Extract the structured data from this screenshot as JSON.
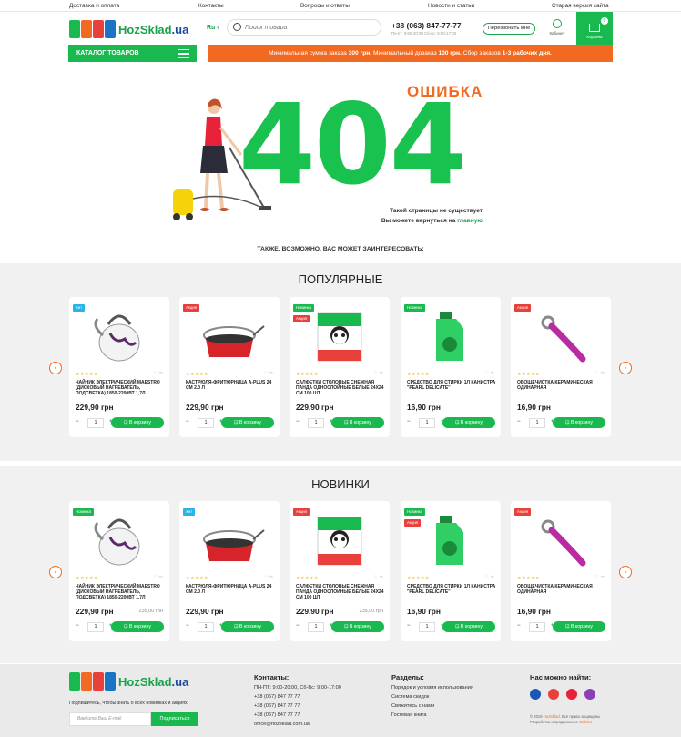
{
  "topbar": {
    "links": [
      "Доставка и оплата",
      "Контакты",
      "Вопросы и ответы",
      "Новости и статьи",
      "Старая версия сайта"
    ]
  },
  "header": {
    "logo_text_green": "HozSklad",
    "logo_text_blue": ".ua",
    "lang": "Ru",
    "search_placeholder": "Поиск товара",
    "phone": "+38 (063) 847-77-77",
    "hours": "Пн-пт: 9:00-20:00 Сб-вс: 9:00-17:00",
    "callback_label": "Перезвонить мне",
    "cabinet_label": "Кабинет",
    "cart_label": "Корзина",
    "cart_count": "0"
  },
  "nav": {
    "catalog_label": "КАТАЛОГ ТОВАРОВ",
    "promo_pre": "Минимальная сумма заказа ",
    "promo_b1": "300 грн.",
    "promo_mid": " Минимальный дозаказ ",
    "promo_b2": "100 грн.",
    "promo_mid2": " Сбор заказов ",
    "promo_b3": "1-3 рабочих дня."
  },
  "error": {
    "title": "ОШИБКА",
    "code": "404",
    "line1": "Такой страницы не существует",
    "line2_pre": "Вы можете вернуться на ",
    "line2_link": "главную"
  },
  "also_label": "ТАКЖЕ, ВОЗМОЖНО, ВАС МОЖЕТ ЗАИНТЕРЕСОВАТЬ:",
  "popular": {
    "title": "ПОПУЛЯРНЫЕ",
    "products": [
      {
        "badges": [
          "Хит"
        ],
        "name": "ЧАЙНИК ЭЛЕКТРИЧЕСКИЙ MAESTRO (ДИСКОВЫЙ НАГРЕВАТЕЛЬ, ПОДСВЕТКА) 1850-2200ВТ 1,7Л",
        "price": "229,90 грн",
        "old": "",
        "stars": "★★★★★",
        "fav": "♡ ⚖",
        "qty": "1",
        "btn": "В корзину"
      },
      {
        "badges": [
          "Акция"
        ],
        "name": "КАСТРЮЛЯ-ФРИТЮРНИЦА A-PLUS 24 СМ 2.0 Л",
        "price": "229,90 грн",
        "old": "",
        "stars": "★★★★★",
        "fav": "♡ ⚖",
        "qty": "1",
        "btn": "В корзину"
      },
      {
        "badges": [
          "Новинка",
          "Акция"
        ],
        "name": "САЛФЕТКИ СТОЛОВЫЕ СНЕЖНАЯ ПАНДА ОДНОСЛОЙНЫЕ БЕЛЫЕ 24Х24 СМ 100 ШТ",
        "price": "229,90 грн",
        "old": "",
        "stars": "★★★★★",
        "fav": "♡ ⚖",
        "qty": "1",
        "btn": "В корзину"
      },
      {
        "badges": [
          "Новинка"
        ],
        "name": "СРЕДСТВО ДЛЯ СТИРКИ 1Л КАНИСТРА \"PEARL DELICATE\"",
        "price": "16,90 грн",
        "old": "",
        "stars": "★★★★★",
        "fav": "♡ ⚖",
        "qty": "1",
        "btn": "В корзину"
      },
      {
        "badges": [
          "Акция"
        ],
        "name": "ОВОЩЕЧИСТКА КЕРАМИЧЕСКАЯ ОДИНАРНАЯ",
        "price": "16,90 грн",
        "old": "",
        "stars": "★★★★★",
        "fav": "♡ ⚖",
        "qty": "1",
        "btn": "В корзину"
      }
    ]
  },
  "new": {
    "title": "НОВИНКИ",
    "products": [
      {
        "badges": [
          "Новинка"
        ],
        "name": "ЧАЙНИК ЭЛЕКТРИЧЕСКИЙ MAESTRO (ДИСКОВЫЙ НАГРЕВАТЕЛЬ, ПОДСВЕТКА) 1850-2200ВТ 1,7Л",
        "price": "229,90 грн",
        "old": "235,00 грн",
        "stars": "★★★★★",
        "fav": "♡ ⚖",
        "qty": "1",
        "btn": "В корзину"
      },
      {
        "badges": [
          "Хит"
        ],
        "name": "КАСТРЮЛЯ-ФРИТЮРНИЦА A-PLUS 24 СМ 2.0 Л",
        "price": "229,90 грн",
        "old": "",
        "stars": "★★★★★",
        "fav": "♡ ⚖",
        "qty": "1",
        "btn": "В корзину"
      },
      {
        "badges": [
          "Акция"
        ],
        "name": "САЛФЕТКИ СТОЛОВЫЕ СНЕЖНАЯ ПАНДА ОДНОСЛОЙНЫЕ БЕЛЫЕ 24Х24 СМ 100 ШТ",
        "price": "229,90 грн",
        "old": "235,00 грн",
        "stars": "★★★★★",
        "fav": "♡ ⚖",
        "qty": "1",
        "btn": "В корзину"
      },
      {
        "badges": [
          "Новинка",
          "Акция"
        ],
        "name": "СРЕДСТВО ДЛЯ СТИРКИ 1Л КАНИСТРА \"PEARL DELICATE\"",
        "price": "16,90 грн",
        "old": "",
        "stars": "★★★★★",
        "fav": "♡ ⚖",
        "qty": "1",
        "btn": "В корзину"
      },
      {
        "badges": [
          "Акция"
        ],
        "name": "ОВОЩЕЧИСТКА КЕРАМИЧЕСКАЯ ОДИНАРНАЯ",
        "price": "16,90 грн",
        "old": "",
        "stars": "★★★★★",
        "fav": "♡ ⚖",
        "qty": "1",
        "btn": "В корзину"
      }
    ]
  },
  "footer": {
    "subscribe_text": "Подпишитесь, чтобы знать о всех новинках и акциях.",
    "email_placeholder": "Введите Ваш E-mail",
    "subscribe_btn": "Подписаться",
    "contacts_title": "Контакты:",
    "contacts": [
      "ПН-ПТ: 9:00-20:00, Сб-Вс: 9:00-17:00",
      "+38 (067) 847 77 77",
      "+38 (067) 847 77 77",
      "+38 (067) 847 77 77",
      "office@hozsklad.com.ua"
    ],
    "sections_title": "Разделы:",
    "sections": [
      "Порядок и условия использования",
      "Система скидок",
      "Свяжитесь с нами",
      "Гостевая книга"
    ],
    "social_title": "Нас можно найти:",
    "copy1_pre": "© 2019 ",
    "copy1_brand": "HozSklad",
    "copy1_post": ". Все права защищены",
    "copy2_pre": "Разработка и продвижение ",
    "copy2_brand": "Webmo"
  },
  "colors": {
    "green": "#1ab94f",
    "orange": "#f26a21",
    "red": "#e8413c",
    "blue": "#28b4e8"
  }
}
